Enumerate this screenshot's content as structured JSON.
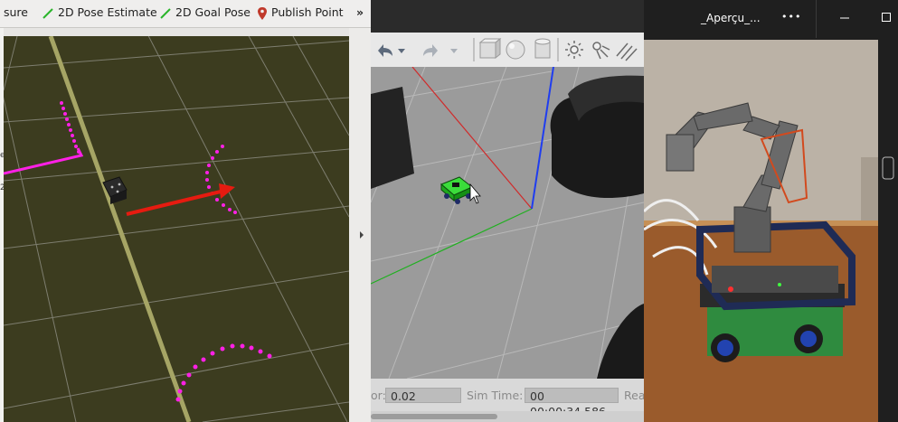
{
  "rviz": {
    "toolbar": {
      "measure_label": "sure",
      "pose_estimate_label": "2D Pose Estimate",
      "goal_pose_label": "2D Goal Pose",
      "publish_point_label": "Publish Point",
      "overflow_label": "»"
    },
    "edge_chars": [
      "e",
      "2"
    ],
    "colors": {
      "grid_background": "#3c3c1f",
      "laser": "#ff20e6",
      "pose_arrow": "#e61b10",
      "grid_line": "#8f8f84"
    }
  },
  "gazebo": {
    "status": {
      "real_time_factor_label": "or:",
      "real_time_factor_value": "0.02",
      "sim_time_label": "Sim Time:",
      "sim_time_value": "00 00:00:34.586",
      "real_time_label": "Rea"
    },
    "colors": {
      "ground": "#9b9b9b",
      "robot": "#1fd01f"
    }
  },
  "viewer": {
    "title": "_Aperçu_...",
    "more_label": "•••"
  }
}
